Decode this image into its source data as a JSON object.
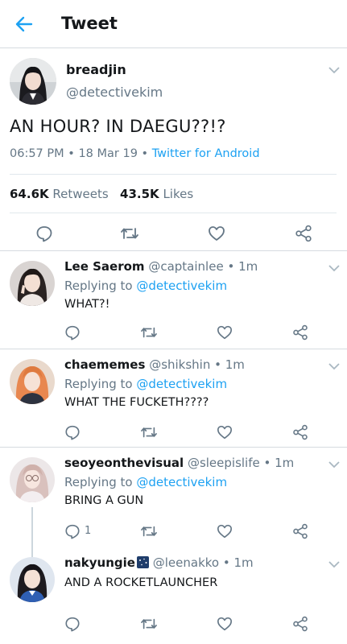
{
  "header": {
    "title": "Tweet"
  },
  "main_tweet": {
    "name": "breadjin",
    "handle": "@detectivekim",
    "text": "AN HOUR? IN DAEGU??!?",
    "time": "06:57 PM",
    "date": "18 Mar 19",
    "client": "Twitter for Android",
    "dot": " • ",
    "retweets_count": "64.6K",
    "retweets_label": "Retweets",
    "likes_count": "43.5K",
    "likes_label": "Likes"
  },
  "replies": [
    {
      "name": "Lee Saerom",
      "handle": "@captainlee",
      "time": "1m",
      "replying_prefix": "Replying to",
      "replying_to": "@detectivekim",
      "text": "WHAT?!",
      "reply_count": ""
    },
    {
      "name": "chaememes",
      "handle": "@shikshin",
      "time": "1m",
      "replying_prefix": "Replying to",
      "replying_to": "@detectivekim",
      "text": "WHAT THE FUCKETH????",
      "reply_count": ""
    },
    {
      "name": "seoyeonthevisual",
      "handle": "@sleepislife",
      "time": "1m",
      "replying_prefix": "Replying to",
      "replying_to": "@detectivekim",
      "text": "BRING A GUN",
      "reply_count": "1"
    },
    {
      "name": "nakyungie",
      "handle": "@leenakko",
      "time": "1m",
      "text": "AND A ROCKETLAUNCHER",
      "reply_count": ""
    }
  ],
  "colors": {
    "accent": "#1da1f2",
    "secondary_text": "#657786",
    "primary_text": "#14171a",
    "divider": "#d6dbe0"
  },
  "icons": [
    "back-arrow-icon",
    "chevron-down-icon",
    "reply-icon",
    "retweet-icon",
    "heart-icon",
    "share-icon"
  ]
}
